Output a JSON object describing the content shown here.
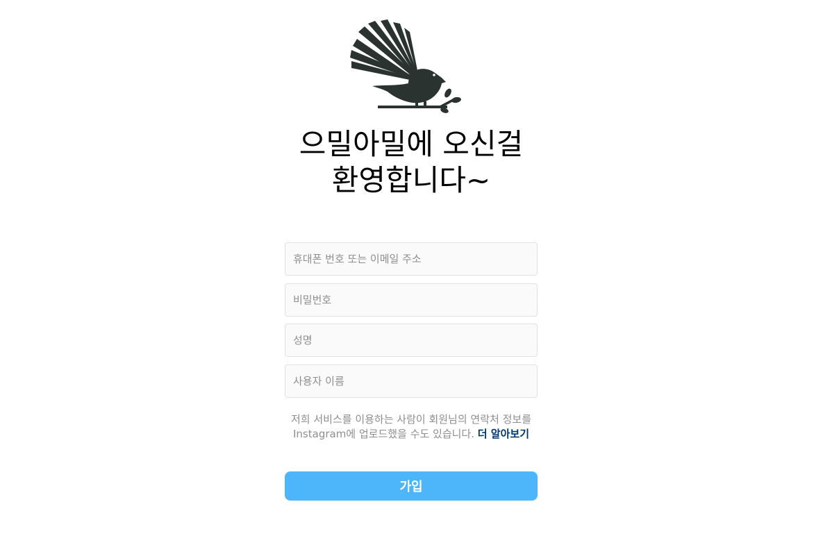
{
  "brand": {
    "logo_icon": "fantail-bird-icon",
    "logo_color": "#2b3330"
  },
  "heading": {
    "line1": "으밀아밀에 오신걸",
    "line2": "환영합니다~"
  },
  "form": {
    "contact_placeholder": "휴대폰 번호 또는 이메일 주소",
    "password_placeholder": "비밀번호",
    "fullname_placeholder": "성명",
    "username_placeholder": "사용자 이름"
  },
  "terms": {
    "text": "저희 서비스를 이용하는 사람이 회원님의 연락처 정보를 Instagram에 업로드했을 수도 있습니다. ",
    "link_label": "더 알아보기"
  },
  "signup": {
    "label": "가입",
    "color": "#4db5f9"
  }
}
